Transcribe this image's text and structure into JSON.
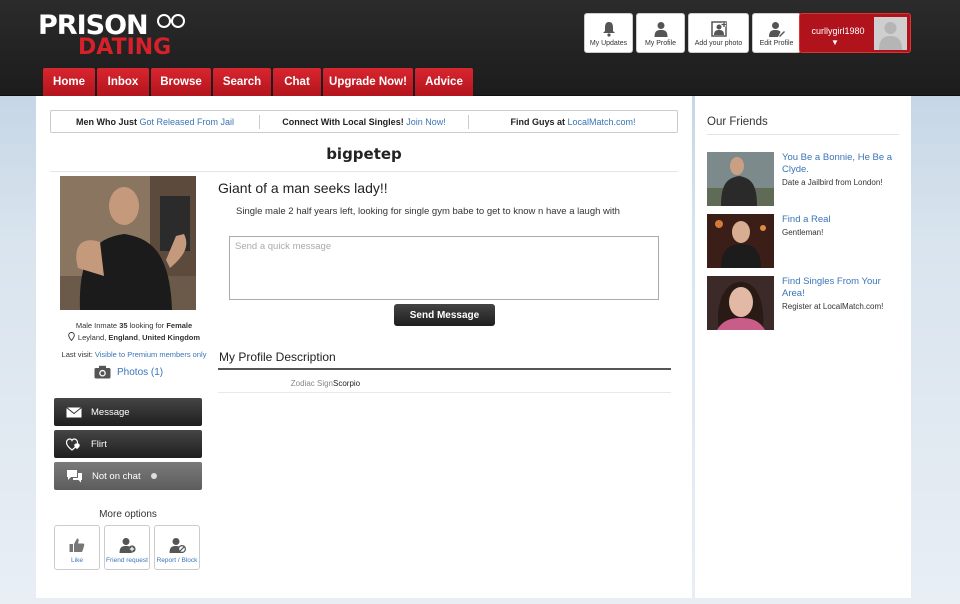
{
  "logo": {
    "line1": "PRISON",
    "line2": "DATING"
  },
  "top_buttons": [
    {
      "label": "My Updates",
      "icon": "bell-icon"
    },
    {
      "label": "My Profile",
      "icon": "person-icon"
    },
    {
      "label": "Add your photo",
      "icon": "add-photo-icon"
    },
    {
      "label": "Edit Profile",
      "icon": "edit-profile-icon"
    }
  ],
  "user": {
    "name": "curllygirl1980",
    "caret": "▼"
  },
  "nav": [
    "Home",
    "Inbox",
    "Browse",
    "Search",
    "Chat",
    "Upgrade Now!",
    "Advice"
  ],
  "promo": [
    {
      "text": "Men Who Just ",
      "link": "Got Released From Jail"
    },
    {
      "text": "Connect With Local Singles! ",
      "link": "Join Now!"
    },
    {
      "text": "Find Guys at ",
      "link": "LocalMatch.com!"
    }
  ],
  "profile": {
    "username": "bigpetep",
    "info_prefix": "Male Inmate ",
    "age": "35",
    "info_mid": " looking for ",
    "seeking": "Female",
    "location_prefix": "Leyland, ",
    "location_region": "England",
    "location_sep": ", ",
    "location_country": "United Kingdom",
    "last_visit_label": "Last visit: ",
    "last_visit_value": "Visible to Premium members only",
    "photos_label": "Photos (1)",
    "headline": "Giant of a man seeks lady!!",
    "description": "Single male 2 half years left, looking for single gym babe to get to know n have a laugh with",
    "message_placeholder": "Send a quick message",
    "send_label": "Send Message",
    "desc_title": "My Profile Description",
    "zodiac_label": "Zodiac Sign",
    "zodiac_value": "Scorpio"
  },
  "actions": {
    "message": "Message",
    "flirt": "Flirt",
    "chat_status": "Not on chat",
    "more_options": "More options",
    "like": "Like",
    "friend_request": "Friend request",
    "report_block": "Report / Block"
  },
  "friends": {
    "title": "Our Friends",
    "items": [
      {
        "title": "You Be a Bonnie, He Be a Clyde.",
        "sub": "Date a Jailbird from London!"
      },
      {
        "title": "Find a Real",
        "sub": "Gentleman!"
      },
      {
        "title": "Find Singles From Your Area!",
        "sub": "Register at LocalMatch.com!"
      }
    ]
  },
  "colors": {
    "brand_red": "#c8202a",
    "link_blue": "#3a74b8",
    "header_dark": "#222222"
  }
}
